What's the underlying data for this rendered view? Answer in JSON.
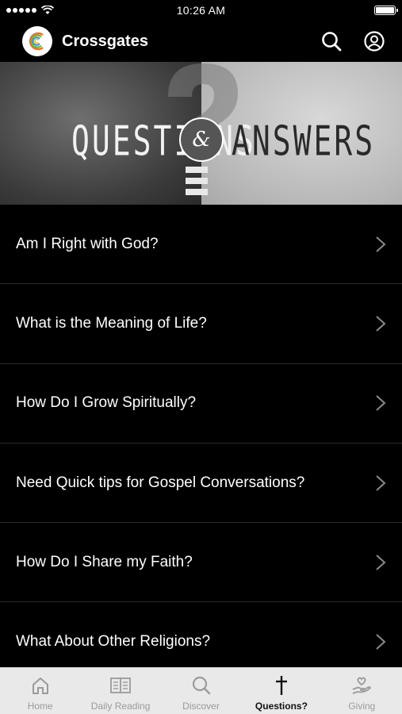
{
  "status_bar": {
    "time": "10:26 AM",
    "signal_icon": "signal-dots-icon",
    "wifi_icon": "wifi-icon",
    "battery_icon": "battery-icon",
    "battery_level": 1.0
  },
  "header": {
    "title": "Crossgates",
    "logo_icon": "church-logo-icon",
    "search_icon": "search-icon",
    "profile_icon": "profile-icon"
  },
  "banner": {
    "left_text": "QUESTIONS",
    "ampersand": "&",
    "right_text": "ANSWERS"
  },
  "list": {
    "items": [
      {
        "label": "Am I Right with God?"
      },
      {
        "label": "What is the Meaning of Life?"
      },
      {
        "label": "How Do I Grow Spiritually?"
      },
      {
        "label": "Need Quick tips for Gospel Conversations?"
      },
      {
        "label": "How Do I Share my Faith?"
      },
      {
        "label": "What About Other Religions?"
      }
    ],
    "chevron_icon": "chevron-right-icon"
  },
  "tab_bar": {
    "tabs": [
      {
        "label": "Home",
        "icon": "home-icon",
        "active": false
      },
      {
        "label": "Daily Reading",
        "icon": "book-icon",
        "active": false
      },
      {
        "label": "Discover",
        "icon": "search-icon",
        "active": false
      },
      {
        "label": "Questions?",
        "icon": "cross-icon",
        "active": true
      },
      {
        "label": "Giving",
        "icon": "giving-hand-heart-icon",
        "active": false
      }
    ]
  },
  "colors": {
    "background": "#000000",
    "tab_bar_bg": "#e9e9e9",
    "tab_inactive": "#9a9a9a",
    "tab_active": "#111111",
    "divider": "#2a2a2a"
  }
}
